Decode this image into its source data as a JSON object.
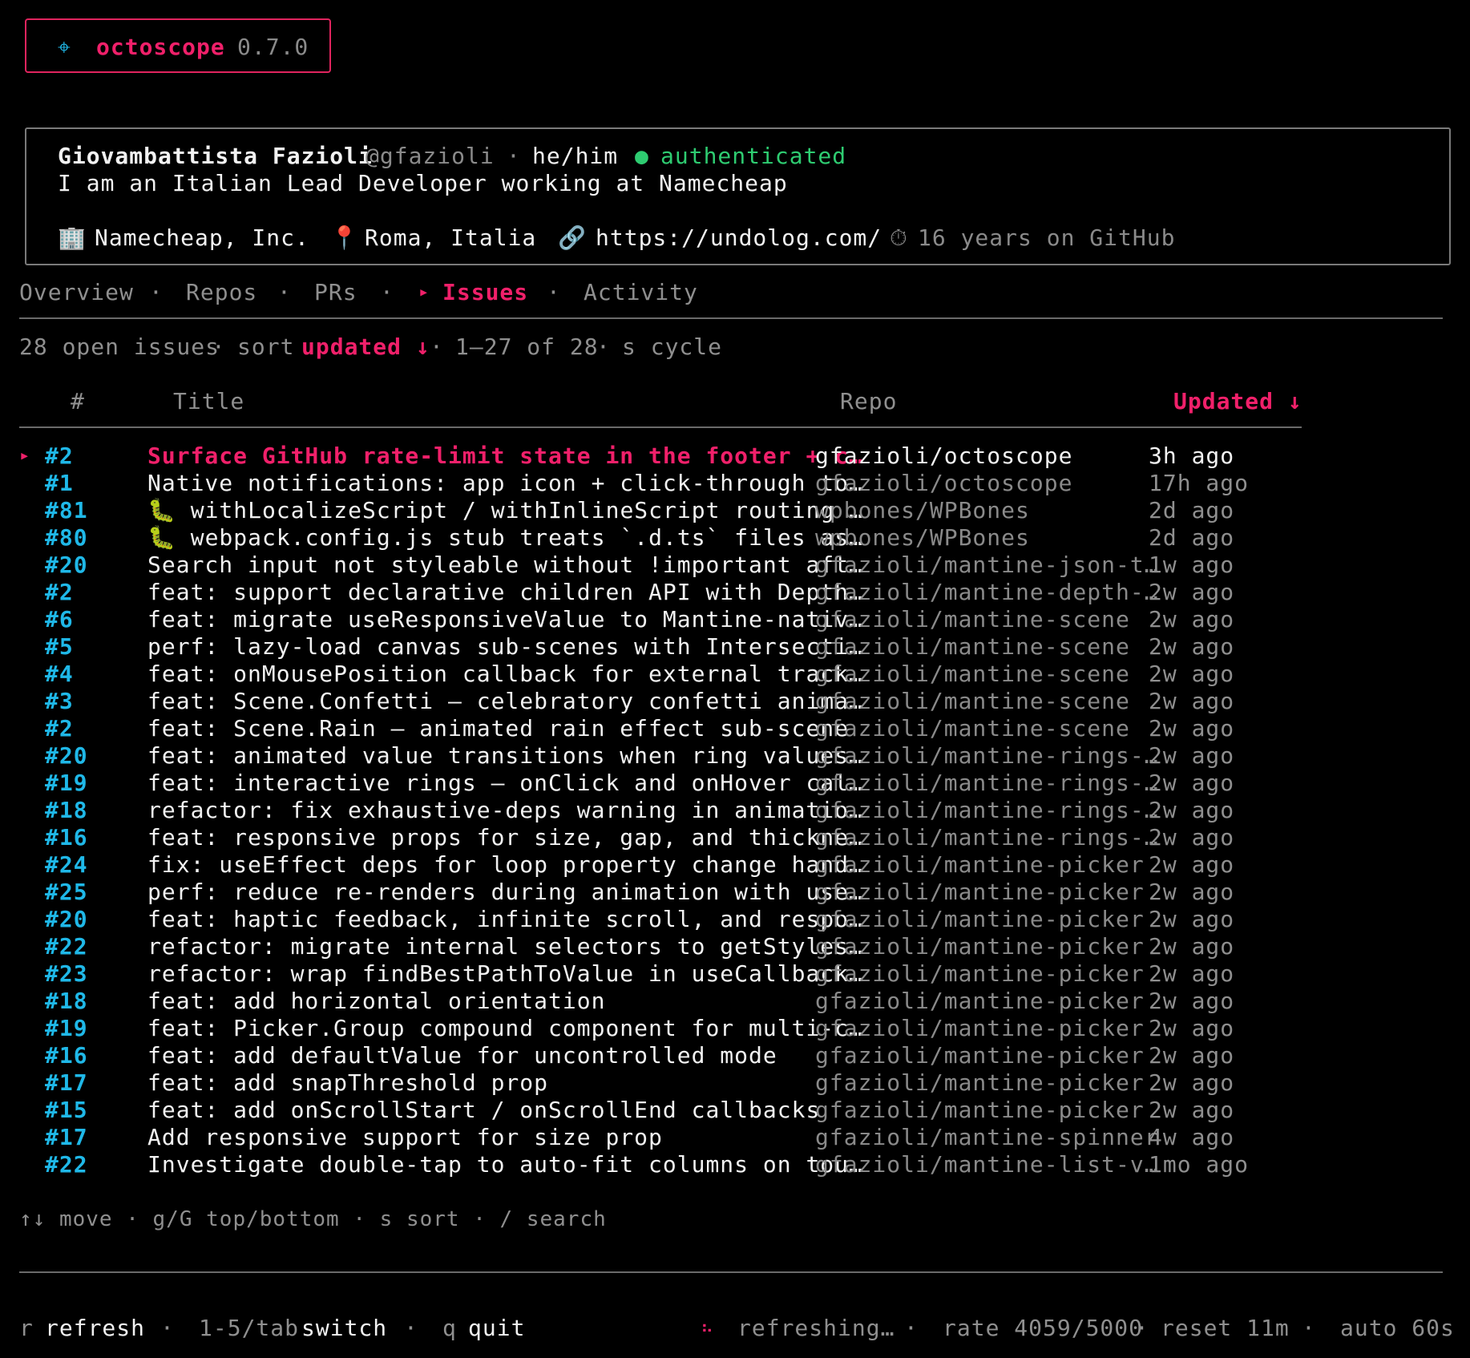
{
  "app": {
    "icon": "⌖",
    "name": "octoscope",
    "version": "0.7.0"
  },
  "profile": {
    "name": "Giovambattista Fazioli",
    "handle": "@gfazioli",
    "sep": "·",
    "pronouns": "he/him",
    "status_dot": "●",
    "status": "authenticated",
    "bio": "I am an Italian Lead Developer working at Namecheap",
    "company_icon": "🏢",
    "company": "Namecheap, Inc.",
    "location_icon": "📍",
    "location": "Roma, Italia",
    "link_icon": "🔗",
    "website": "https://undolog.com/",
    "age_icon": "⏱",
    "age": "16 years on GitHub"
  },
  "tabs": [
    {
      "label": "Overview"
    },
    {
      "label": "Repos"
    },
    {
      "label": "PRs"
    },
    {
      "label": "Issues",
      "active": true,
      "marker": "▸"
    },
    {
      "label": "Activity"
    }
  ],
  "tab_sep": "·",
  "summary": {
    "count": "28 open issues",
    "sort_label": "sort",
    "sort_value": "updated ↓",
    "range": "1–27 of 28",
    "hint": "s cycle",
    "sep": "·"
  },
  "table": {
    "headers": {
      "num": "#",
      "title": "Title",
      "repo": "Repo",
      "updated": "Updated ↓"
    },
    "selected_marker": "▸",
    "rows": [
      {
        "num": "#2",
        "title": "Surface GitHub rate-limit state in the footer + c…",
        "repo": "gfazioli/octoscope",
        "updated": "3h ago",
        "selected": true
      },
      {
        "num": "#1",
        "title": "Native notifications: app icon + click-through to…",
        "repo": "gfazioli/octoscope",
        "updated": "17h ago"
      },
      {
        "num": "#81",
        "title": "🐛 withLocalizeScript / withInlineScript routing …",
        "repo": "wpbones/WPBones",
        "updated": "2d ago"
      },
      {
        "num": "#80",
        "title": "🐛 webpack.config.js stub treats `.d.ts` files as…",
        "repo": "wpbones/WPBones",
        "updated": "2d ago"
      },
      {
        "num": "#20",
        "title": "Search input not styleable without !important aft…",
        "repo": "gfazioli/mantine-json-t…",
        "updated": "1w ago"
      },
      {
        "num": "#2",
        "title": "feat: support declarative children API with Depth…",
        "repo": "gfazioli/mantine-depth-…",
        "updated": "2w ago"
      },
      {
        "num": "#6",
        "title": "feat: migrate useResponsiveValue to Mantine-nativ…",
        "repo": "gfazioli/mantine-scene",
        "updated": "2w ago"
      },
      {
        "num": "#5",
        "title": "perf: lazy-load canvas sub-scenes with Intersecti…",
        "repo": "gfazioli/mantine-scene",
        "updated": "2w ago"
      },
      {
        "num": "#4",
        "title": "feat: onMousePosition callback for external track…",
        "repo": "gfazioli/mantine-scene",
        "updated": "2w ago"
      },
      {
        "num": "#3",
        "title": "feat: Scene.Confetti — celebratory confetti anima…",
        "repo": "gfazioli/mantine-scene",
        "updated": "2w ago"
      },
      {
        "num": "#2",
        "title": "feat: Scene.Rain — animated rain effect sub-scene",
        "repo": "gfazioli/mantine-scene",
        "updated": "2w ago"
      },
      {
        "num": "#20",
        "title": "feat: animated value transitions when ring values…",
        "repo": "gfazioli/mantine-rings-…",
        "updated": "2w ago"
      },
      {
        "num": "#19",
        "title": "feat: interactive rings — onClick and onHover cal…",
        "repo": "gfazioli/mantine-rings-…",
        "updated": "2w ago"
      },
      {
        "num": "#18",
        "title": "refactor: fix exhaustive-deps warning in animatio…",
        "repo": "gfazioli/mantine-rings-…",
        "updated": "2w ago"
      },
      {
        "num": "#16",
        "title": "feat: responsive props for size, gap, and thickne…",
        "repo": "gfazioli/mantine-rings-…",
        "updated": "2w ago"
      },
      {
        "num": "#24",
        "title": "fix: useEffect deps for loop property change hand…",
        "repo": "gfazioli/mantine-picker",
        "updated": "2w ago"
      },
      {
        "num": "#25",
        "title": "perf: reduce re-renders during animation with use…",
        "repo": "gfazioli/mantine-picker",
        "updated": "2w ago"
      },
      {
        "num": "#20",
        "title": "feat: haptic feedback, infinite scroll, and respo…",
        "repo": "gfazioli/mantine-picker",
        "updated": "2w ago"
      },
      {
        "num": "#22",
        "title": "refactor: migrate internal selectors to getStyles…",
        "repo": "gfazioli/mantine-picker",
        "updated": "2w ago"
      },
      {
        "num": "#23",
        "title": "refactor: wrap findBestPathToValue in useCallback…",
        "repo": "gfazioli/mantine-picker",
        "updated": "2w ago"
      },
      {
        "num": "#18",
        "title": "feat: add horizontal orientation",
        "repo": "gfazioli/mantine-picker",
        "updated": "2w ago"
      },
      {
        "num": "#19",
        "title": "feat: Picker.Group compound component for multi-c…",
        "repo": "gfazioli/mantine-picker",
        "updated": "2w ago"
      },
      {
        "num": "#16",
        "title": "feat: add defaultValue for uncontrolled mode",
        "repo": "gfazioli/mantine-picker",
        "updated": "2w ago"
      },
      {
        "num": "#17",
        "title": "feat: add snapThreshold prop",
        "repo": "gfazioli/mantine-picker",
        "updated": "2w ago"
      },
      {
        "num": "#15",
        "title": "feat: add onScrollStart / onScrollEnd callbacks",
        "repo": "gfazioli/mantine-picker",
        "updated": "2w ago"
      },
      {
        "num": "#17",
        "title": "Add responsive support for size prop",
        "repo": "gfazioli/mantine-spinner",
        "updated": "4w ago"
      },
      {
        "num": "#22",
        "title": "Investigate double-tap to auto-fit columns on tou…",
        "repo": "gfazioli/mantine-list-v…",
        "updated": "1mo ago"
      }
    ]
  },
  "hints": "↑↓ move · g/G top/bottom · s sort · / search",
  "footer": {
    "refresh_key": "r",
    "refresh_label": "refresh",
    "switch_key": "1-5/tab",
    "switch_label": "switch",
    "quit_key": "q",
    "quit_label": "quit",
    "sep": "·",
    "spinner": "⠦",
    "status": "refreshing…",
    "rate": "rate 4059/5000",
    "reset": "reset 11m",
    "auto": "auto 60s"
  },
  "colors": {
    "accent": "#f0206a",
    "number": "#1fb8e8",
    "ok": "#2ecc71",
    "border": "#7a7a7a"
  }
}
